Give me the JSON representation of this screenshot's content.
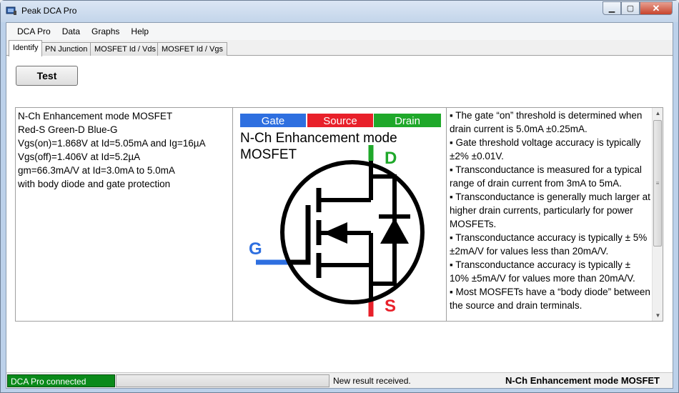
{
  "window": {
    "title": "Peak DCA Pro",
    "icon": "app-icon"
  },
  "menu": [
    "DCA Pro",
    "Data",
    "Graphs",
    "Help"
  ],
  "tabs": [
    {
      "label": "Identify",
      "active": true
    },
    {
      "label": "PN Junction",
      "active": false
    },
    {
      "label": "MOSFET Id / Vds",
      "active": false
    },
    {
      "label": "MOSFET Id / Vgs",
      "active": false
    }
  ],
  "test_button": "Test",
  "result": {
    "lines": [
      "N-Ch Enhancement mode MOSFET",
      "Red-S Green-D Blue-G",
      "Vgs(on)=1.868V at Id=5.05mA and Ig=16µA",
      "Vgs(off)=1.406V at Id=5.2µA",
      "gm=66.3mA/V at Id=3.0mA to 5.0mA",
      "with body diode and gate protection"
    ]
  },
  "diagram": {
    "legend": [
      {
        "label": "Gate",
        "color": "#2e6fe0"
      },
      {
        "label": "Source",
        "color": "#e8202a"
      },
      {
        "label": "Drain",
        "color": "#1fa82a"
      }
    ],
    "title_line1": "N-Ch Enhancement mode",
    "title_line2": "MOSFET",
    "pin_d": "D",
    "pin_g": "G",
    "pin_s": "S"
  },
  "notes": [
    "▪ The gate “on” threshold is determined when drain current is 5.0mA ±0.25mA.",
    "▪ Gate threshold voltage accuracy is typically ±2% ±0.01V.",
    "▪ Transconductance is measured for a typical range of drain current from 3mA to 5mA.",
    "▪ Transconductance is generally much larger at higher drain currents, particularly for power MOSFETs.",
    "▪ Transconductance accuracy is typically ± 5% ±2mA/V for values less than 20mA/V.",
    "▪ Transconductance accuracy is typically ± 10% ±5mA/V for values more than 20mA/V.",
    "▪ Most MOSFETs have a “body diode” between the source and drain terminals."
  ],
  "status": {
    "connection": "DCA Pro connected",
    "connection_color": "#0a8a1a",
    "progress_percent": 0,
    "message": "New result received.",
    "result_summary": "N-Ch Enhancement mode MOSFET"
  }
}
